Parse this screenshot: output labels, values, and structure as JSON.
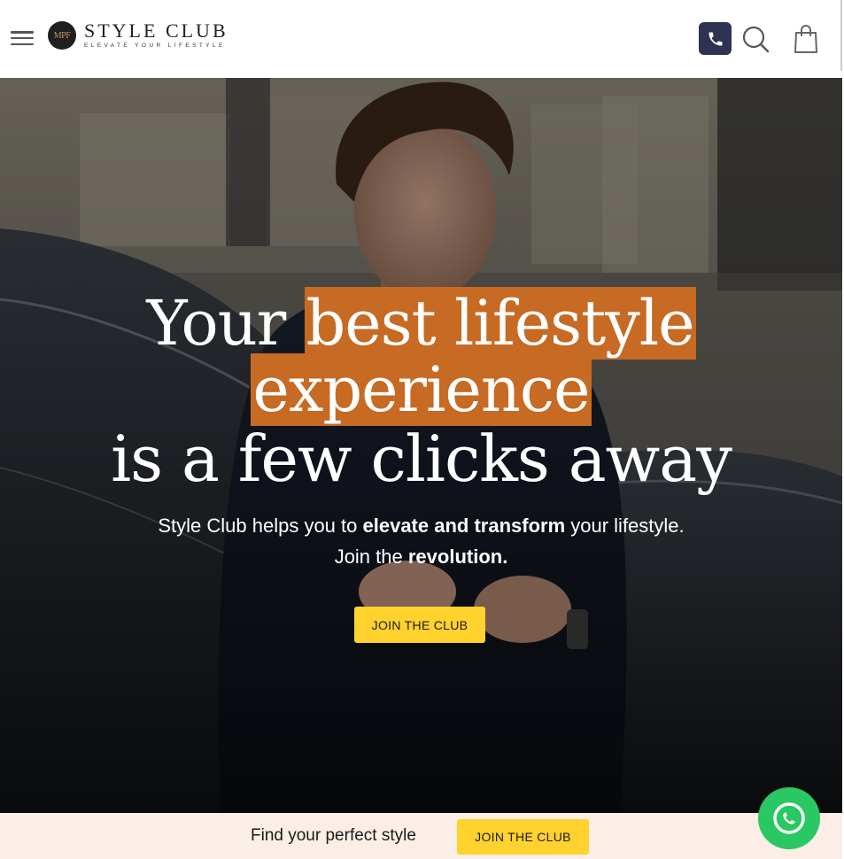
{
  "header": {
    "logo_mark": "MPF",
    "logo_title": "STYLE CLUB",
    "logo_tagline": "ELEVATE YOUR LIFESTYLE"
  },
  "hero": {
    "heading_plain_1": "Your ",
    "heading_highlight_1": "best lifestyle",
    "heading_highlight_2": "experience",
    "heading_line_3": "is a few clicks away",
    "sub_1": "Style Club helps you to ",
    "sub_1_bold": "elevate and transform",
    "sub_1_end": " your lifestyle.",
    "sub_2": "Join the ",
    "sub_2_bold": "revolution.",
    "cta_label": "JOIN THE CLUB"
  },
  "sticky_bar": {
    "text": "Find your perfect style",
    "cta_label": "JOIN THE CLUB"
  },
  "colors": {
    "highlight": "#c76a23",
    "cta_yellow": "#ffd22e",
    "phone_button": "#2d3350",
    "sticky_bg": "#fbeee6",
    "whatsapp": "#29c862"
  },
  "icons": [
    "hamburger-menu-icon",
    "phone-icon",
    "search-icon",
    "shopping-bag-icon",
    "whatsapp-icon"
  ]
}
